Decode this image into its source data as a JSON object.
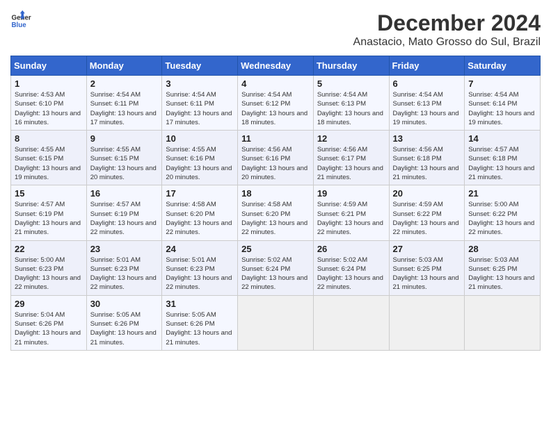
{
  "header": {
    "logo_line1": "General",
    "logo_line2": "Blue",
    "title": "December 2024",
    "subtitle": "Anastacio, Mato Grosso do Sul, Brazil"
  },
  "weekdays": [
    "Sunday",
    "Monday",
    "Tuesday",
    "Wednesday",
    "Thursday",
    "Friday",
    "Saturday"
  ],
  "weeks": [
    [
      {
        "day": "1",
        "sunrise": "4:53 AM",
        "sunset": "6:10 PM",
        "daylight": "13 hours and 16 minutes."
      },
      {
        "day": "2",
        "sunrise": "4:54 AM",
        "sunset": "6:11 PM",
        "daylight": "13 hours and 17 minutes."
      },
      {
        "day": "3",
        "sunrise": "4:54 AM",
        "sunset": "6:11 PM",
        "daylight": "13 hours and 17 minutes."
      },
      {
        "day": "4",
        "sunrise": "4:54 AM",
        "sunset": "6:12 PM",
        "daylight": "13 hours and 18 minutes."
      },
      {
        "day": "5",
        "sunrise": "4:54 AM",
        "sunset": "6:13 PM",
        "daylight": "13 hours and 18 minutes."
      },
      {
        "day": "6",
        "sunrise": "4:54 AM",
        "sunset": "6:13 PM",
        "daylight": "13 hours and 19 minutes."
      },
      {
        "day": "7",
        "sunrise": "4:54 AM",
        "sunset": "6:14 PM",
        "daylight": "13 hours and 19 minutes."
      }
    ],
    [
      {
        "day": "8",
        "sunrise": "4:55 AM",
        "sunset": "6:15 PM",
        "daylight": "13 hours and 19 minutes."
      },
      {
        "day": "9",
        "sunrise": "4:55 AM",
        "sunset": "6:15 PM",
        "daylight": "13 hours and 20 minutes."
      },
      {
        "day": "10",
        "sunrise": "4:55 AM",
        "sunset": "6:16 PM",
        "daylight": "13 hours and 20 minutes."
      },
      {
        "day": "11",
        "sunrise": "4:56 AM",
        "sunset": "6:16 PM",
        "daylight": "13 hours and 20 minutes."
      },
      {
        "day": "12",
        "sunrise": "4:56 AM",
        "sunset": "6:17 PM",
        "daylight": "13 hours and 21 minutes."
      },
      {
        "day": "13",
        "sunrise": "4:56 AM",
        "sunset": "6:18 PM",
        "daylight": "13 hours and 21 minutes."
      },
      {
        "day": "14",
        "sunrise": "4:57 AM",
        "sunset": "6:18 PM",
        "daylight": "13 hours and 21 minutes."
      }
    ],
    [
      {
        "day": "15",
        "sunrise": "4:57 AM",
        "sunset": "6:19 PM",
        "daylight": "13 hours and 21 minutes."
      },
      {
        "day": "16",
        "sunrise": "4:57 AM",
        "sunset": "6:19 PM",
        "daylight": "13 hours and 22 minutes."
      },
      {
        "day": "17",
        "sunrise": "4:58 AM",
        "sunset": "6:20 PM",
        "daylight": "13 hours and 22 minutes."
      },
      {
        "day": "18",
        "sunrise": "4:58 AM",
        "sunset": "6:20 PM",
        "daylight": "13 hours and 22 minutes."
      },
      {
        "day": "19",
        "sunrise": "4:59 AM",
        "sunset": "6:21 PM",
        "daylight": "13 hours and 22 minutes."
      },
      {
        "day": "20",
        "sunrise": "4:59 AM",
        "sunset": "6:22 PM",
        "daylight": "13 hours and 22 minutes."
      },
      {
        "day": "21",
        "sunrise": "5:00 AM",
        "sunset": "6:22 PM",
        "daylight": "13 hours and 22 minutes."
      }
    ],
    [
      {
        "day": "22",
        "sunrise": "5:00 AM",
        "sunset": "6:23 PM",
        "daylight": "13 hours and 22 minutes."
      },
      {
        "day": "23",
        "sunrise": "5:01 AM",
        "sunset": "6:23 PM",
        "daylight": "13 hours and 22 minutes."
      },
      {
        "day": "24",
        "sunrise": "5:01 AM",
        "sunset": "6:23 PM",
        "daylight": "13 hours and 22 minutes."
      },
      {
        "day": "25",
        "sunrise": "5:02 AM",
        "sunset": "6:24 PM",
        "daylight": "13 hours and 22 minutes."
      },
      {
        "day": "26",
        "sunrise": "5:02 AM",
        "sunset": "6:24 PM",
        "daylight": "13 hours and 22 minutes."
      },
      {
        "day": "27",
        "sunrise": "5:03 AM",
        "sunset": "6:25 PM",
        "daylight": "13 hours and 21 minutes."
      },
      {
        "day": "28",
        "sunrise": "5:03 AM",
        "sunset": "6:25 PM",
        "daylight": "13 hours and 21 minutes."
      }
    ],
    [
      {
        "day": "29",
        "sunrise": "5:04 AM",
        "sunset": "6:26 PM",
        "daylight": "13 hours and 21 minutes."
      },
      {
        "day": "30",
        "sunrise": "5:05 AM",
        "sunset": "6:26 PM",
        "daylight": "13 hours and 21 minutes."
      },
      {
        "day": "31",
        "sunrise": "5:05 AM",
        "sunset": "6:26 PM",
        "daylight": "13 hours and 21 minutes."
      },
      null,
      null,
      null,
      null
    ]
  ]
}
